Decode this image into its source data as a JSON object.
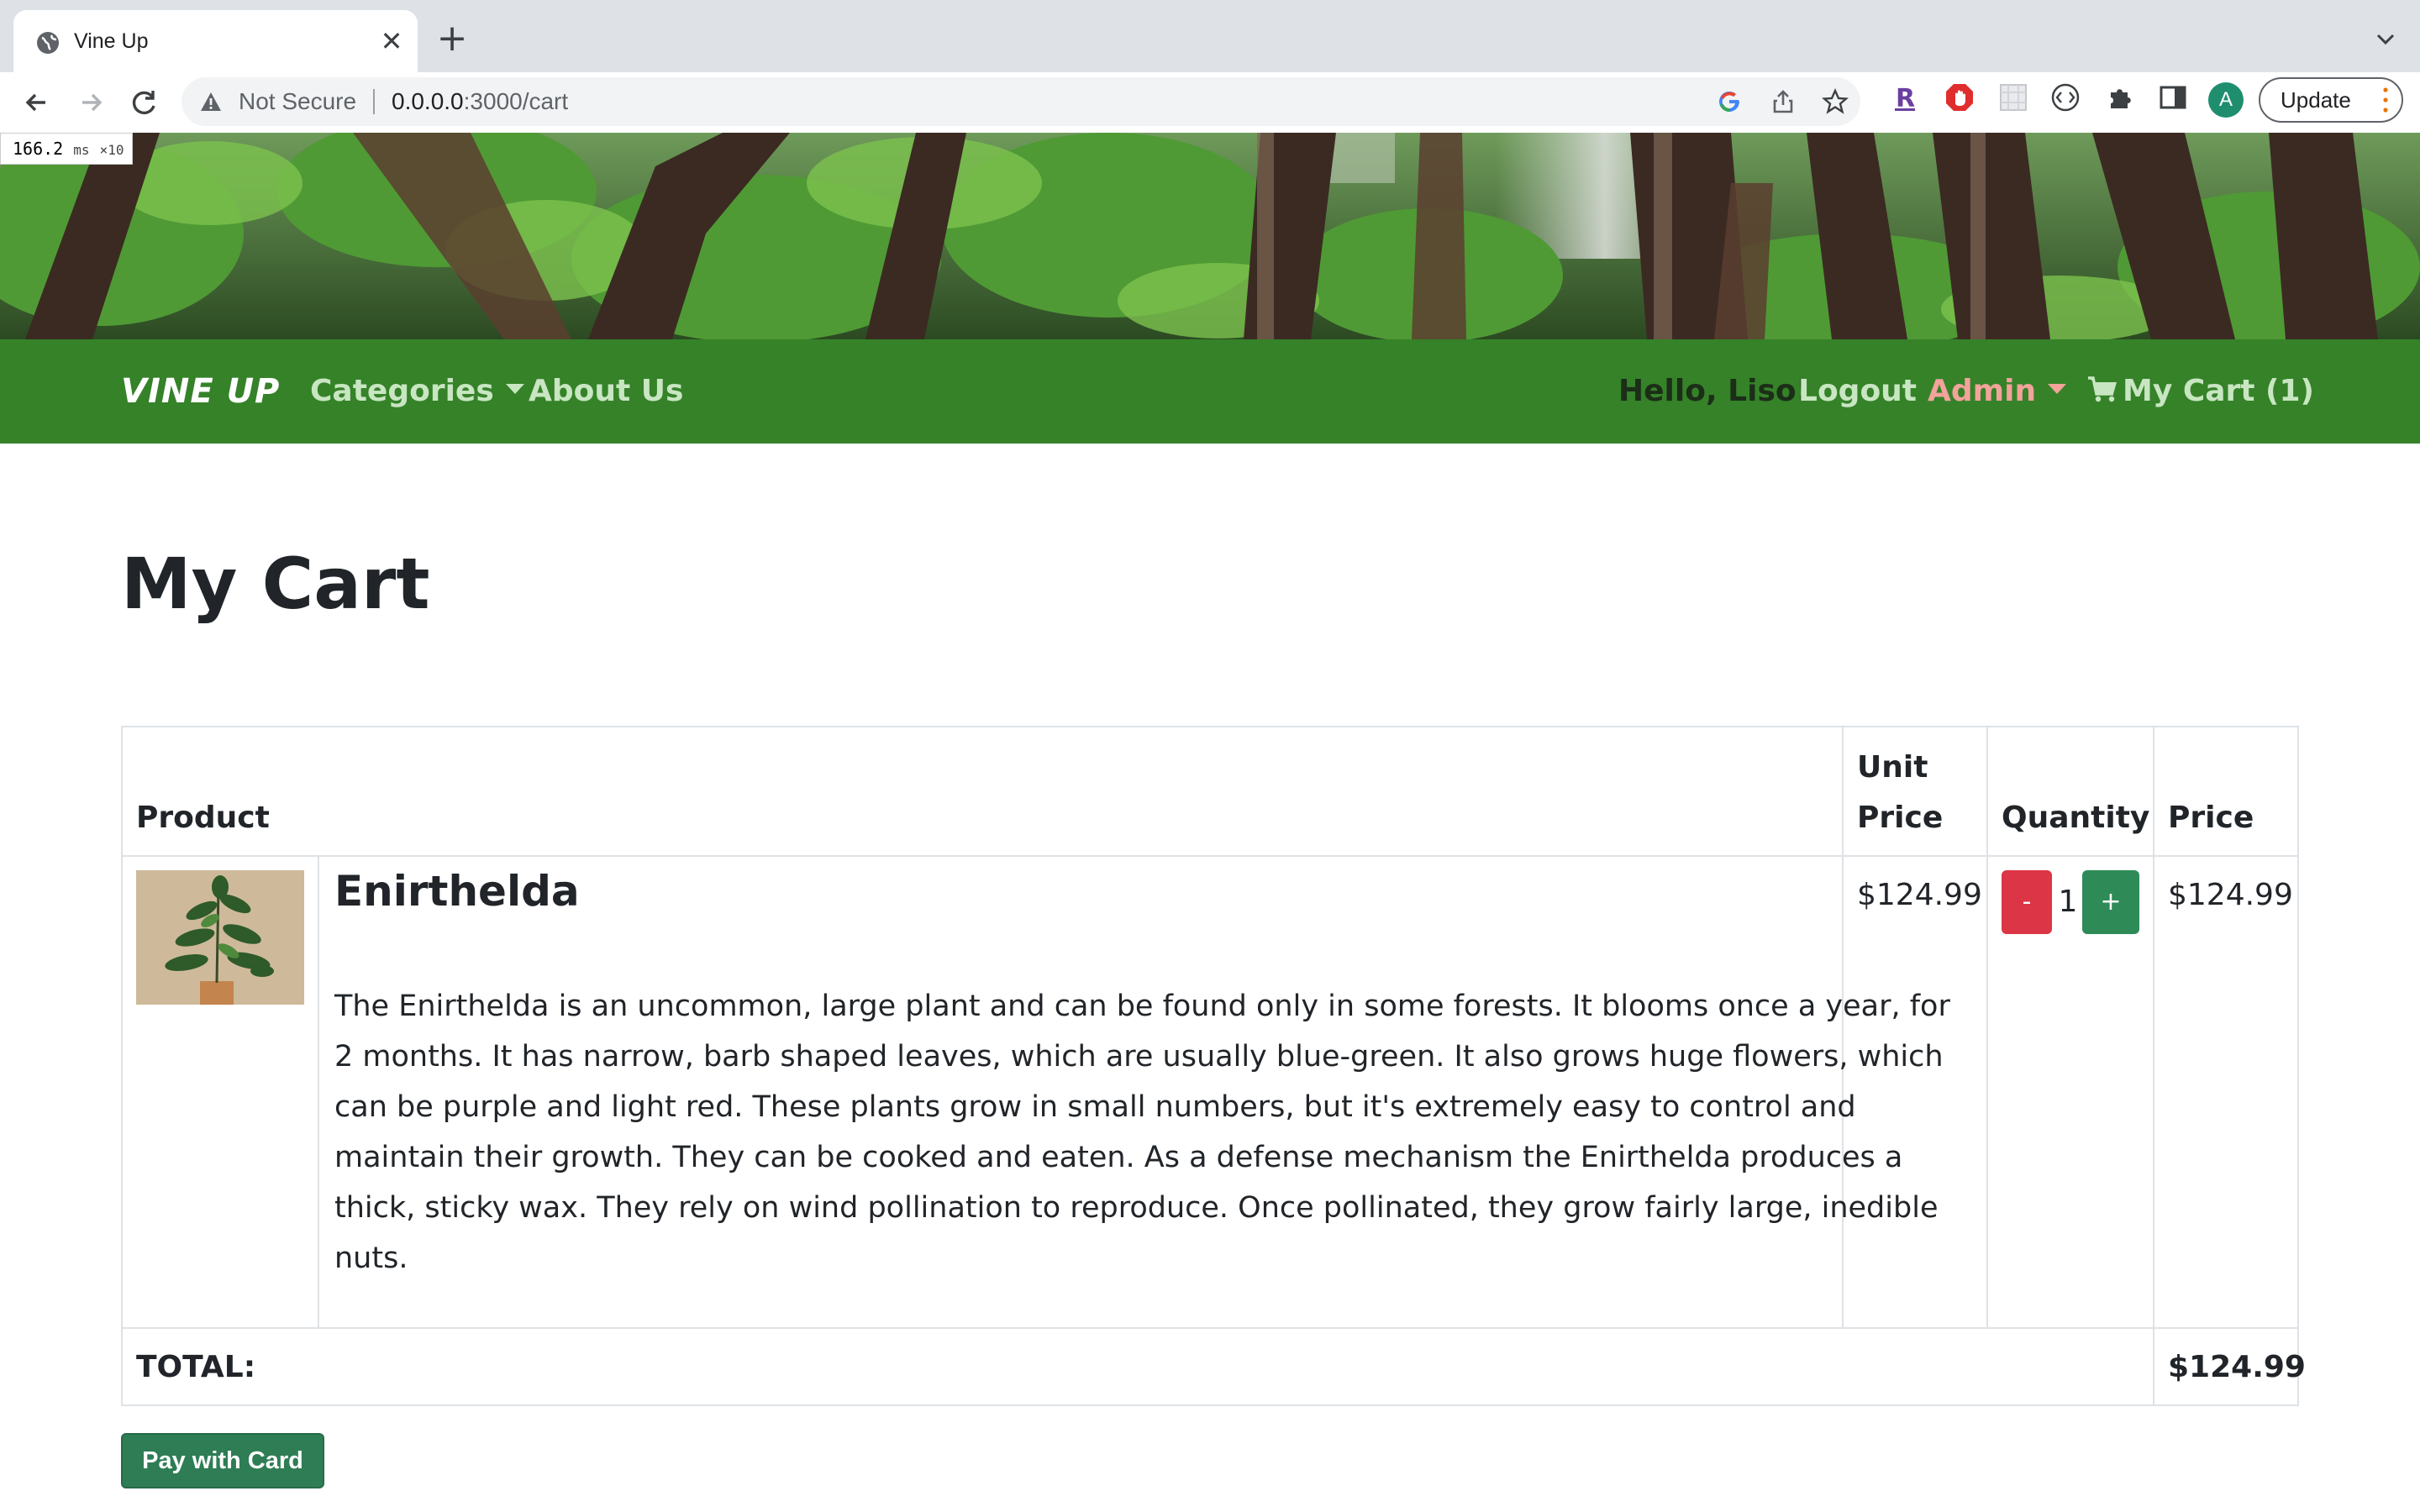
{
  "browser": {
    "tab_title": "Vine Up",
    "tab_close": "✕",
    "new_tab": "+",
    "security_label": "Not Secure",
    "url_host": "0.0.0.0",
    "url_path": ":3000/cart",
    "profile_initial": "A",
    "update_label": "Update"
  },
  "perf": {
    "value": "166.2",
    "unit": "ms",
    "multiplier": "×10"
  },
  "navbar": {
    "brand": "VINE UP",
    "categories": "Categories",
    "about": "About Us",
    "greeting": "Hello, Liso!",
    "logout": "Logout",
    "admin": "Admin",
    "cart": "My Cart (1)"
  },
  "page": {
    "title": "My Cart"
  },
  "table": {
    "headers": {
      "product": "Product",
      "unit_price_1": "Unit",
      "unit_price_2": "Price",
      "quantity": "Quantity",
      "price": "Price"
    },
    "rows": [
      {
        "name": "Enirthelda",
        "description": "The Enirthelda is an uncommon, large plant and can be found only in some forests. It blooms once a year, for 2 months. It has narrow, barb shaped leaves, which are usually blue-green. It also grows huge flowers, which can be purple and light red. These plants grow in small numbers, but it's extremely easy to control and maintain their growth. They can be cooked and eaten. As a defense mechanism the Enirthelda produces a thick, sticky wax. They rely on wind pollination to reproduce. Once pollinated, they grow fairly large, inedible nuts.",
        "unit_price": "$124.99",
        "quantity": "1",
        "minus": "-",
        "plus": "+",
        "price": "$124.99"
      }
    ],
    "total_label": "TOTAL:",
    "total_value": "$124.99"
  },
  "pay_button": "Pay with Card",
  "colors": {
    "navbar": "#358229",
    "minus_button": "#dc3545",
    "plus_button": "#2e8b57",
    "pay_button": "#2e7d55",
    "admin_link": "#f2a39a"
  }
}
